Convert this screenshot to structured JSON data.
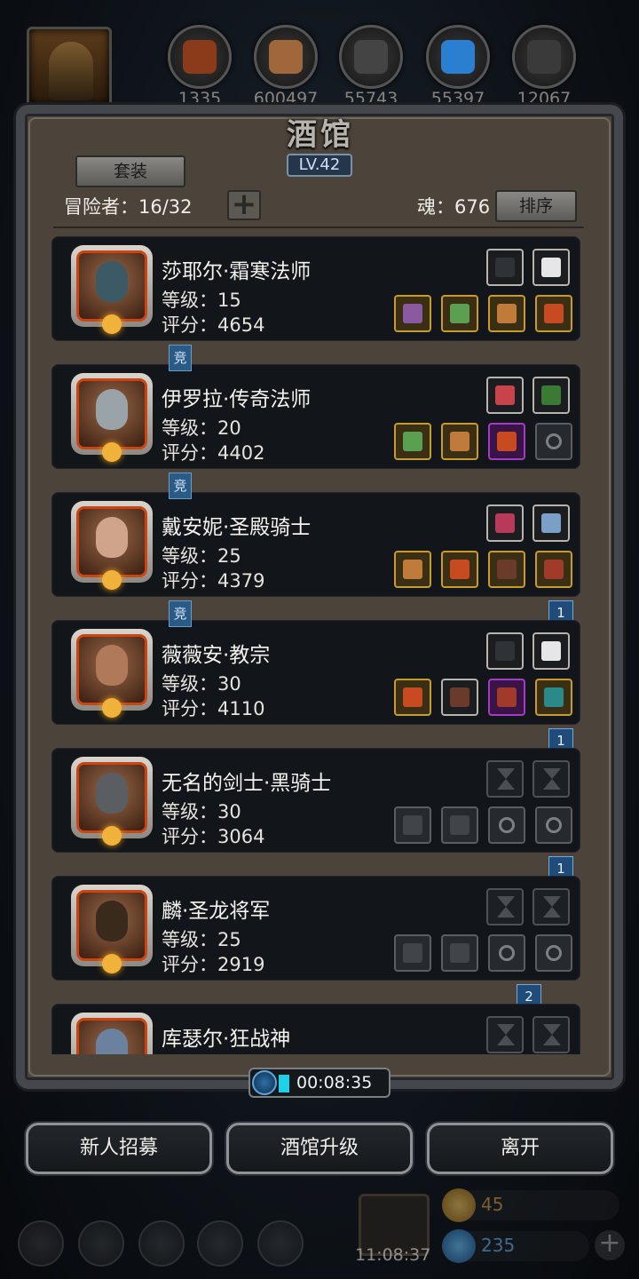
{
  "resources": [
    {
      "name": "meat",
      "value": "1335",
      "color": "#8b3a1a"
    },
    {
      "name": "wood",
      "value": "600497",
      "color": "#a0683a"
    },
    {
      "name": "iron",
      "value": "55743",
      "color": "#444"
    },
    {
      "name": "crystal",
      "value": "55397",
      "color": "#2b7fd0"
    },
    {
      "name": "stone",
      "value": "12067",
      "color": "#3a3a3a"
    }
  ],
  "tavern": {
    "title": "酒馆",
    "level": "LV.42",
    "set_label": "套装",
    "adventurers": "冒险者：16/32",
    "plus": "+",
    "soul": "魂：676",
    "sort_label": "排序"
  },
  "heroes": [
    {
      "name": "莎耶尔·霜寒法师",
      "level": "等级：15",
      "score": "评分：4654",
      "top_slots": [
        "plain",
        "plain"
      ],
      "slots": [
        "gold",
        "gold",
        "gold",
        "gold"
      ]
    },
    {
      "name": "伊罗拉·传奇法师",
      "level": "等级：20",
      "score": "评分：4402",
      "top_slots": [
        "plain",
        "plain"
      ],
      "slots": [
        "gold",
        "gold",
        "purple",
        "empty-ring"
      ],
      "badge": "竞"
    },
    {
      "name": "戴安妮·圣殿骑士",
      "level": "等级：25",
      "score": "评分：4379",
      "top_slots": [
        "plain",
        "plain"
      ],
      "slots": [
        "gold",
        "gold",
        "gold",
        "gold"
      ],
      "badge": "竞",
      "flag": "1"
    },
    {
      "name": "薇薇安·教宗",
      "level": "等级：30",
      "score": "评分：4110",
      "top_slots": [
        "plain",
        "plain"
      ],
      "slots": [
        "gold",
        "plain",
        "purple",
        "gold"
      ],
      "badge": "竞",
      "flag": "1"
    },
    {
      "name": "无名的剑士·黑骑士",
      "level": "等级：30",
      "score": "评分：3064",
      "top_slots": [
        "hour",
        "hour"
      ],
      "slots": [
        "empty",
        "empty",
        "empty-ring",
        "empty-ring"
      ],
      "flag": "1"
    },
    {
      "name": "麟·圣龙将军",
      "level": "等级：25",
      "score": "评分：2919",
      "top_slots": [
        "hour",
        "hour"
      ],
      "slots": [
        "empty",
        "empty",
        "empty-ring",
        "empty-ring"
      ],
      "flag": "2"
    },
    {
      "name": "库瑟尔·狂战神",
      "level": "",
      "score": "",
      "top_slots": [
        "hour",
        "hour"
      ],
      "slots": []
    }
  ],
  "timer": "00:08:35",
  "buttons": {
    "recruit": "新人招募",
    "upgrade": "酒馆升级",
    "leave": "离开"
  },
  "footer": {
    "gift_time": "11:08:37",
    "gold": "45",
    "gem": "235",
    "plus": "+"
  }
}
